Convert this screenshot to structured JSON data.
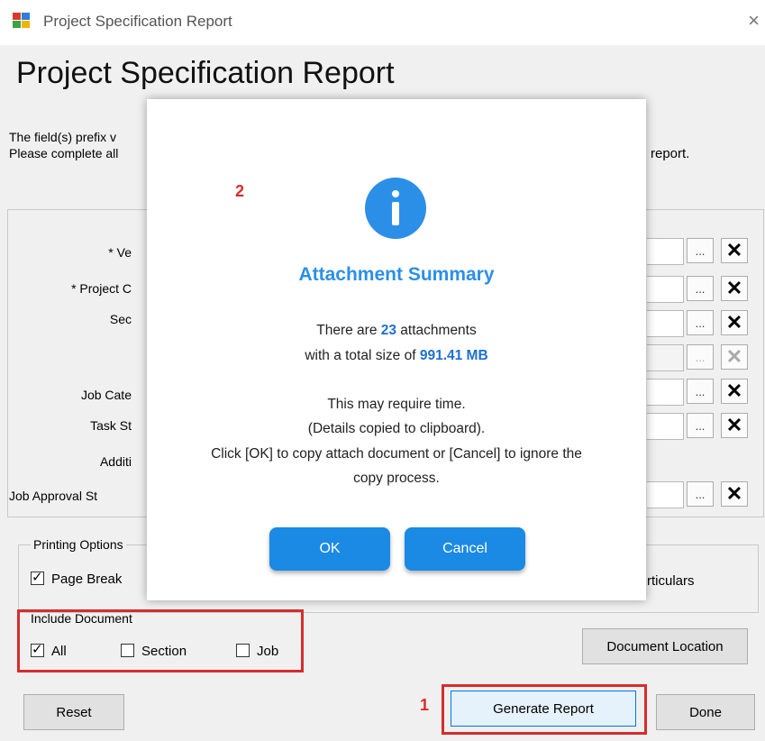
{
  "window": {
    "title": "Project Specification Report",
    "close_glyph": "×"
  },
  "page": {
    "heading": "Project Specification Report",
    "info_line1": "The field(s) prefix v",
    "info_line2": "Please complete all",
    "info_line2_end": "report."
  },
  "fields": [
    {
      "label": "* Ve",
      "dots": "...",
      "clear": "✕",
      "enabled": true
    },
    {
      "label": "* Project C",
      "dots": "...",
      "clear": "✕",
      "enabled": true
    },
    {
      "label": "Sec",
      "dots": "...",
      "clear": "✕",
      "enabled": true
    },
    {
      "label": "",
      "dots": "...",
      "clear": "✕",
      "enabled": false
    },
    {
      "label": "Job Cate",
      "dots": "...",
      "clear": "✕",
      "enabled": true
    },
    {
      "label": "Task St",
      "dots": "...",
      "clear": "✕",
      "enabled": true
    },
    {
      "label": "Additi"
    },
    {
      "label": "Job Approval St",
      "dots": "...",
      "clear": "✕",
      "enabled": true
    }
  ],
  "printing": {
    "group_label": "Printing Options",
    "page_break_label": "Page Break",
    "page_break_checked": true,
    "particulars_label": "rticulars"
  },
  "include_document": {
    "group_label": "Include Document",
    "all_label": "All",
    "all_checked": true,
    "section_label": "Section",
    "section_checked": false,
    "job_label": "Job",
    "job_checked": false,
    "location_button": "Document Location"
  },
  "buttons": {
    "reset": "Reset",
    "generate": "Generate Report",
    "done": "Done"
  },
  "annotations": {
    "step1": "1",
    "step2": "2",
    "color": "#d62d2d"
  },
  "dialog": {
    "icon": "info-icon",
    "title": "Attachment Summary",
    "line1_prefix": "There are ",
    "attachment_count": "23",
    "line1_suffix": " attachments",
    "line2_prefix": "with a total size of ",
    "total_size": "991.41 MB",
    "line3": "This may require time.",
    "line4": "(Details copied to clipboard).",
    "line5": "Click [OK] to copy attach document or [Cancel] to ignore the",
    "line6": "copy process.",
    "ok": "OK",
    "cancel": "Cancel",
    "accent": "#2b8fe8"
  }
}
